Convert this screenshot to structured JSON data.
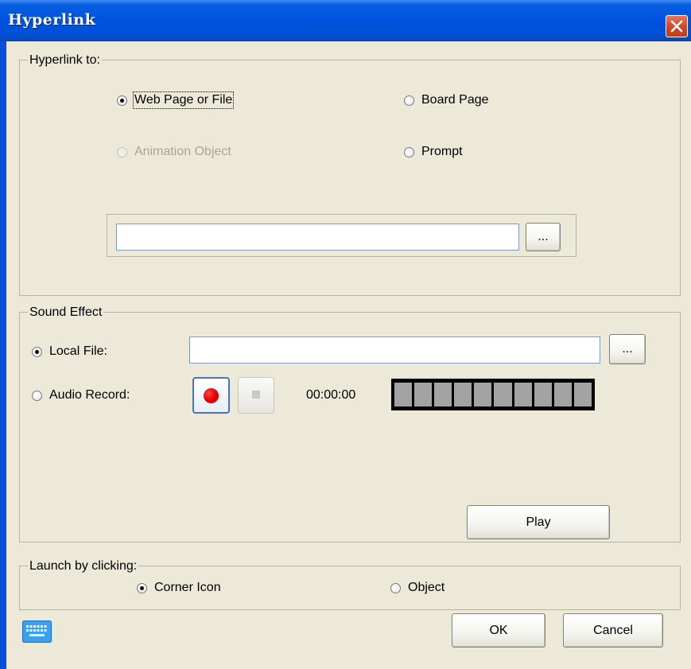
{
  "window": {
    "title": "Hyperlink",
    "close_icon": "close-icon"
  },
  "hyperlink_to": {
    "legend": "Hyperlink to:",
    "options": [
      {
        "label": "Web Page or File",
        "checked": true,
        "disabled": false
      },
      {
        "label": "Board Page",
        "checked": false,
        "disabled": false
      },
      {
        "label": "Animation Object",
        "checked": false,
        "disabled": true
      },
      {
        "label": "Prompt",
        "checked": false,
        "disabled": false
      }
    ],
    "path_value": "",
    "browse_label": "..."
  },
  "sound_effect": {
    "legend": "Sound Effect",
    "local_file_label": "Local File:",
    "local_file_checked": true,
    "local_file_value": "",
    "browse_label": "...",
    "audio_record_label": "Audio Record:",
    "audio_record_checked": false,
    "time": "00:00:00",
    "level_meter_segments": 10,
    "play_label": "Play",
    "record_color": "#e00000"
  },
  "launch_by_clicking": {
    "legend": "Launch by clicking:",
    "options": [
      {
        "label": "Corner Icon",
        "checked": true
      },
      {
        "label": "Object",
        "checked": false
      }
    ]
  },
  "footer": {
    "keyboard_icon": "keyboard-icon",
    "ok_label": "OK",
    "cancel_label": "Cancel"
  },
  "colors": {
    "titlebar": "#0053e0",
    "dialog_bg": "#ece9d8",
    "close_button": "#d4482a"
  }
}
